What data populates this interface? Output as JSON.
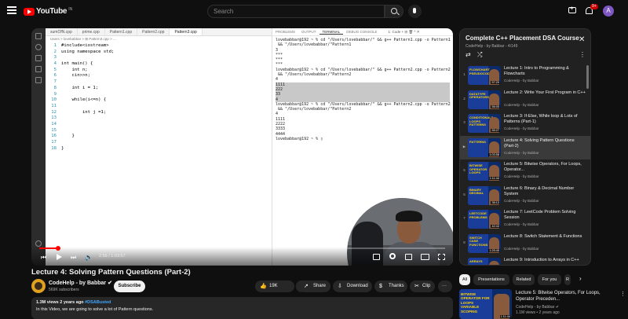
{
  "header": {
    "logo_text": "YouTube",
    "logo_country": "IN",
    "search_placeholder": "Search",
    "notifications": "9+",
    "avatar_letter": "A"
  },
  "editor": {
    "tabs": [
      "sumOfN.cpp",
      "prime.cpp",
      "Pattern1.cpp",
      "Pattern2.cpp",
      "Pattern3.cpp"
    ],
    "active_tab": 4,
    "breadcrumb": "Users > lovebabbar > ⊞ Pattern3.cpp > ...",
    "lines": [
      {
        "n": "1",
        "t": "#include<iostream>"
      },
      {
        "n": "2",
        "t": "using namespace std;"
      },
      {
        "n": "3",
        "t": ""
      },
      {
        "n": "4",
        "t": "int main() {"
      },
      {
        "n": "5",
        "t": "    int n;"
      },
      {
        "n": "6",
        "t": "    cin>>n;"
      },
      {
        "n": "7",
        "t": ""
      },
      {
        "n": "8",
        "t": "    int i = 1;"
      },
      {
        "n": "9",
        "t": ""
      },
      {
        "n": "10",
        "t": "    while(i<=n) {"
      },
      {
        "n": "11",
        "t": ""
      },
      {
        "n": "12",
        "t": "        int j =1;"
      },
      {
        "n": "13",
        "t": ""
      },
      {
        "n": "14",
        "t": ""
      },
      {
        "n": "15",
        "t": ""
      },
      {
        "n": "16",
        "t": "    }"
      },
      {
        "n": "17",
        "t": ""
      },
      {
        "n": "18",
        "t": "}"
      }
    ]
  },
  "terminal": {
    "tabs": [
      "PROBLEMS",
      "OUTPUT",
      "TERMINAL",
      "DEBUG CONSOLE"
    ],
    "active_tab": 2,
    "tools": "1: Code   +  ⊟  🗑  ^  ✕",
    "lines": [
      {
        "t": "lovebabbar@192 ~ % cd \"/Users/lovebabbar/\" && g++ Pattern1.cpp -o Pattern1",
        "sel": false
      },
      {
        "t": " && \"/Users/lovebabbar/\"Pattern1",
        "sel": false
      },
      {
        "t": "3",
        "sel": false
      },
      {
        "t": "***",
        "sel": false
      },
      {
        "t": "***",
        "sel": false
      },
      {
        "t": "***",
        "sel": false
      },
      {
        "t": "lovebabbar@192 ~ % cd \"/Users/lovebabbar/\" && g++ Pattern2.cpp -o Pattern2",
        "sel": false
      },
      {
        "t": " && \"/Users/lovebabbar/\"Pattern2",
        "sel": false
      },
      {
        "t": "4",
        "sel": false
      },
      {
        "t": "1111",
        "sel": true
      },
      {
        "t": "222",
        "sel": true
      },
      {
        "t": "33",
        "sel": true
      },
      {
        "t": "4",
        "sel": true
      },
      {
        "t": "lovebabbar@192 ~ % cd \"/Users/lovebabbar/\" && g++ Pattern2.cpp -o Pattern2",
        "sel": false
      },
      {
        "t": " && \"/Users/lovebabbar/\"Pattern2",
        "sel": false
      },
      {
        "t": "4",
        "sel": false
      },
      {
        "t": "1111",
        "sel": false
      },
      {
        "t": "2222",
        "sel": false
      },
      {
        "t": "3333",
        "sel": false
      },
      {
        "t": "4444",
        "sel": false
      },
      {
        "t": "lovebabbar@192 ~ % ▯",
        "sel": false
      }
    ]
  },
  "player": {
    "time": "2:56 / 1:03:57",
    "progress_fraction": 0.046
  },
  "video": {
    "title": "Lecture 4: Solving Pattern Questions (Part-2)",
    "channel": "CodeHelp - by Babbar ✔",
    "subscribers": "569K subscribers",
    "subscribe_label": "Subscribe",
    "likes": "19K",
    "share_label": "Share",
    "download_label": "Download",
    "thanks_label": "Thanks",
    "clip_label": "Clip",
    "more_label": "···",
    "views_meta": "1.3M views  2 years ago  ",
    "hashtag": "#DSABusted",
    "description": "In this Video, we are going to solve a lot of Pattern questions."
  },
  "playlist": {
    "title": "Complete C++ Placement DSA Course",
    "subtitle": "CodeHelp - by Babbar - 4/149",
    "items": [
      {
        "idx": "1",
        "title": "Lecture 1: Intro to Programming & Flowcharts",
        "channel": "CodeHelp - by Babbar",
        "thumb": "FLOWCHART PSEUDOCODE",
        "dur": "57:29",
        "current": false
      },
      {
        "idx": "2",
        "title": "Lecture 2: Write Your First Program in C++",
        "channel": "CodeHelp - by Babbar",
        "thumb": "DATATYPE OPERATORS",
        "dur": "56:05",
        "current": false
      },
      {
        "idx": "3",
        "title": "Lecture 3: If-Else, While loop & Lots of Patterns (Part-1)",
        "channel": "CodeHelp - by Babbar",
        "thumb": "CONDITIONALS LOOPS PATTERNS",
        "dur": "55:27",
        "current": false
      },
      {
        "idx": "▶",
        "title": "Lecture 4: Solving Pattern Questions (Part-2)",
        "channel": "CodeHelp - by Babbar",
        "thumb": "PATTERNS",
        "dur": "1:03:58",
        "current": true
      },
      {
        "idx": "5",
        "title": "Lecture 5: Bitwise Operators, For Loops, Operator...",
        "channel": "CodeHelp - by Babbar",
        "thumb": "BITWISE OPERATOR LOOPS",
        "dur": "1:11:44",
        "current": false
      },
      {
        "idx": "6",
        "title": "Lecture 6: Binary & Decimal Number System",
        "channel": "CodeHelp - by Babbar",
        "thumb": "BINARY DECIMAL",
        "dur": "36:13",
        "current": false
      },
      {
        "idx": "7",
        "title": "Lecture 7: LeetCode Problem Solving Session",
        "channel": "CodeHelp - by Babbar",
        "thumb": "LEETCODE PROBLEMS",
        "dur": "42:43",
        "current": false
      },
      {
        "idx": "8",
        "title": "Lecture 8: Switch Statement & Functions",
        "channel": "CodeHelp - by Babbar",
        "thumb": "SWITCH CASE FUNCTIONS",
        "dur": "1:25:45",
        "current": false
      },
      {
        "idx": "9",
        "title": "Lecture 9: Introduction to Arrays in C++",
        "channel": "CodeHelp - by Babbar",
        "thumb": "ARRAYS",
        "dur": "1:23:54",
        "current": false
      }
    ]
  },
  "chips": [
    "All",
    "Presentations",
    "Related",
    "For you",
    "R"
  ],
  "recommendation": {
    "title": "Lecture 5: Bitwise Operators, For Loops, Operator Preceden...",
    "channel": "CodeHelp - by Babbar ✔",
    "meta": "1.1M views • 2 years ago",
    "thumb": "BITWISE OPERATOR FOR LOOPS VARIABLE SCOPING",
    "dur": "1:11:44"
  },
  "colors": {
    "accent_red": "#ff0000",
    "bg": "#0f0f0f",
    "link_blue": "#3ea6ff"
  }
}
